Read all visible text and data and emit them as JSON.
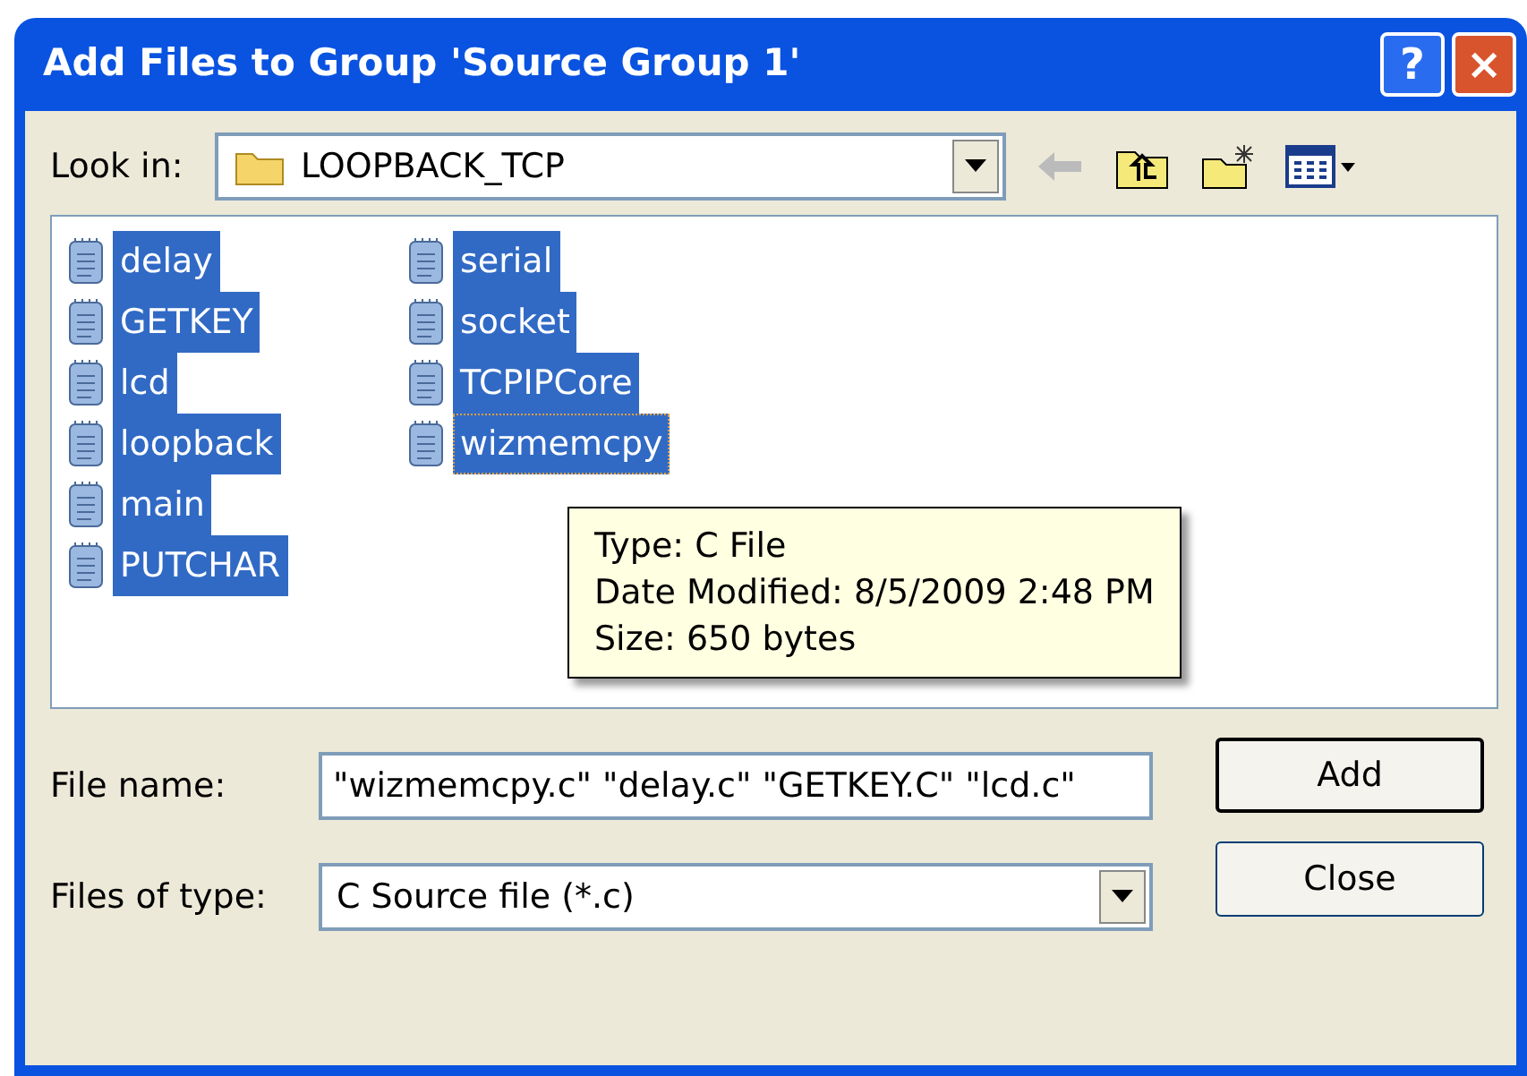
{
  "window": {
    "title": "Add Files to Group 'Source Group 1'",
    "help_button": "?",
    "close_button": "×"
  },
  "look_in": {
    "label": "Look in:",
    "value": "LOOPBACK_TCP"
  },
  "files": [
    {
      "name": "delay",
      "selected": true,
      "focused": false
    },
    {
      "name": "GETKEY",
      "selected": true,
      "focused": false
    },
    {
      "name": "lcd",
      "selected": true,
      "focused": false
    },
    {
      "name": "loopback",
      "selected": true,
      "focused": false
    },
    {
      "name": "main",
      "selected": true,
      "focused": false
    },
    {
      "name": "PUTCHAR",
      "selected": true,
      "focused": false
    },
    {
      "name": "serial",
      "selected": true,
      "focused": false
    },
    {
      "name": "socket",
      "selected": true,
      "focused": false
    },
    {
      "name": "TCPIPCore",
      "selected": true,
      "focused": false
    },
    {
      "name": "wizmemcpy",
      "selected": true,
      "focused": true
    }
  ],
  "tooltip": [
    "Type: C File",
    "Date Modified: 8/5/2009 2:48 PM",
    "Size: 650 bytes"
  ],
  "file_name": {
    "label": "File name:",
    "value": "\"wizmemcpy.c\" \"delay.c\" \"GETKEY.C\" \"lcd.c\""
  },
  "files_of_type": {
    "label": "Files of type:",
    "value": "C Source file (*.c)"
  },
  "buttons": [
    {
      "label": "Add",
      "default": true
    },
    {
      "label": "Close",
      "default": false
    }
  ]
}
